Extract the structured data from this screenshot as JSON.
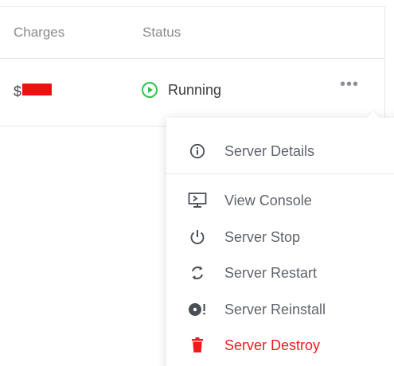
{
  "table": {
    "headers": {
      "charges": "Charges",
      "status": "Status"
    },
    "row": {
      "charge_prefix": "$",
      "status_label": "Running",
      "status_icon": "play-circle-icon",
      "actions_icon": "more-horizontal-icon",
      "actions_glyph": "•••"
    }
  },
  "menu": {
    "items": [
      {
        "label": "Server Details",
        "icon": "info-icon"
      },
      {
        "label": "View Console",
        "icon": "console-icon"
      },
      {
        "label": "Server Stop",
        "icon": "power-icon"
      },
      {
        "label": "Server Restart",
        "icon": "refresh-icon"
      },
      {
        "label": "Server Reinstall",
        "icon": "disc-icon"
      },
      {
        "label": "Server Destroy",
        "icon": "trash-icon"
      }
    ]
  },
  "colors": {
    "running": "#2ec44a",
    "danger": "#ef1b1b",
    "icon": "#4a4f57",
    "redaction": "#ee1111"
  }
}
